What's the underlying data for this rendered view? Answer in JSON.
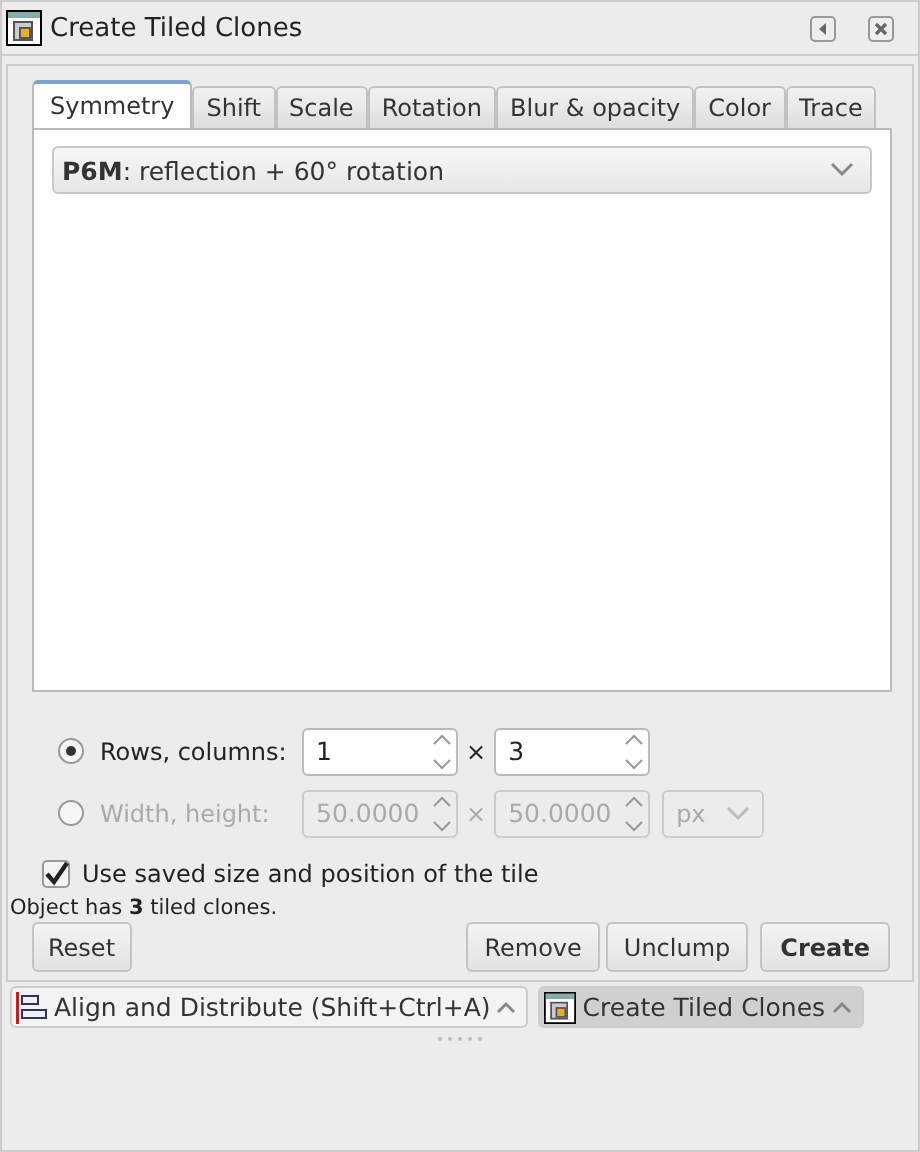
{
  "window": {
    "title": "Create Tiled Clones"
  },
  "tabs": [
    {
      "label": "Symmetry",
      "selected": true
    },
    {
      "label": "Shift",
      "selected": false
    },
    {
      "label": "Scale",
      "selected": false
    },
    {
      "label": "Rotation",
      "selected": false
    },
    {
      "label": "Blur & opacity",
      "selected": false
    },
    {
      "label": "Color",
      "selected": false
    },
    {
      "label": "Trace",
      "selected": false
    }
  ],
  "symmetry_select": {
    "value": "**P6M**: reflection + 60° rotation"
  },
  "size_options": [
    {
      "label": "Rows, columns:",
      "selected": true,
      "fields": [
        {
          "value": "1",
          "disabled": false
        },
        {
          "value": "3",
          "disabled": false
        }
      ],
      "separator": "×",
      "disabled": false
    },
    {
      "label": "Width, height:",
      "selected": false,
      "fields": [
        {
          "value": "50.0000",
          "disabled": true
        },
        {
          "value": "50.0000",
          "disabled": true
        }
      ],
      "separator": "×",
      "disabled": true,
      "unit": "px"
    }
  ],
  "use_saved": {
    "label": "Use saved size and position of the tile",
    "checked": true
  },
  "status": "Object has **3** tiled clones.",
  "buttons": [
    {
      "label": "Reset",
      "kind": "left"
    },
    {
      "label": "Remove",
      "kind": "normal"
    },
    {
      "label": "Unclump",
      "kind": "normal"
    },
    {
      "label": "Create",
      "kind": "primary"
    }
  ],
  "dock_tabs": [
    {
      "label": "Align and Distribute (Shift+Ctrl+A)",
      "selected": false
    },
    {
      "label": "Create Tiled Clones",
      "selected": true
    }
  ]
}
